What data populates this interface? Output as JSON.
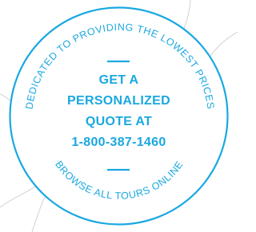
{
  "colors": {
    "accent": "#1aa8e0",
    "map_lines": "#d2d2d2",
    "background": "#ffffff"
  },
  "badge": {
    "top_arc_text": "DEDICATED TO PROVIDING THE LOWEST PRICES",
    "bottom_arc_text": "BROWSE ALL TOURS ONLINE",
    "center_lines": {
      "line1": "GET A",
      "line2": "PERSONALIZED",
      "line3": "QUOTE AT",
      "phone": "1-800-387-1460"
    }
  }
}
